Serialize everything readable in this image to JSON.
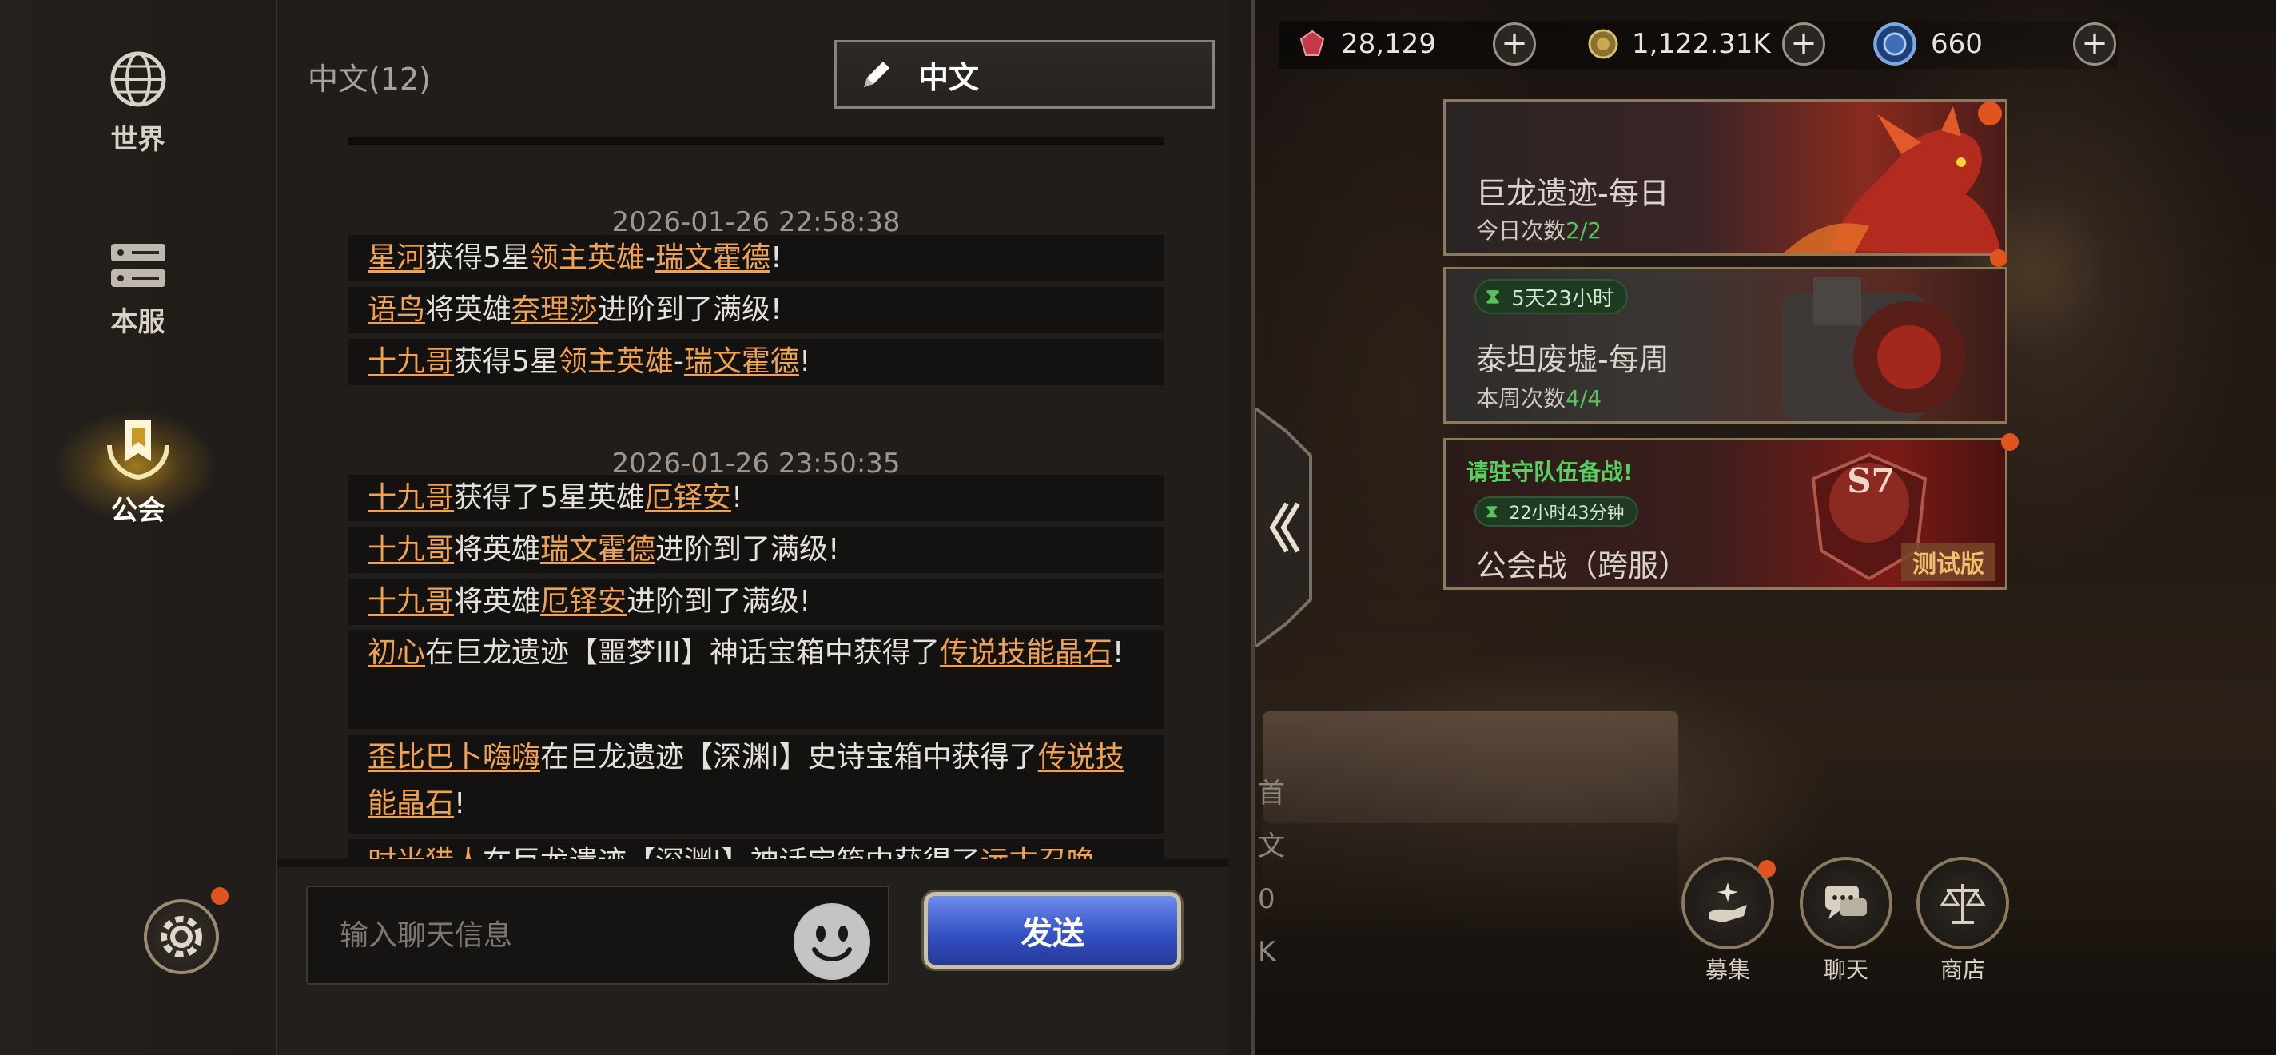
{
  "left_nav": {
    "items": [
      {
        "label": "世界",
        "icon": "globe-icon"
      },
      {
        "label": "本服",
        "icon": "server-icon"
      },
      {
        "label": "公会",
        "icon": "guild-emblem-icon",
        "active": true
      }
    ]
  },
  "chat": {
    "channel_title": "中文(12)",
    "language_button": "中文",
    "groups": [
      {
        "timestamp": "2026-01-26 22:58:38",
        "messages": [
          [
            {
              "t": "星河",
              "l": true
            },
            {
              "t": "获得5星"
            },
            {
              "t": "领主英雄",
              "o": true
            },
            {
              "t": "-"
            },
            {
              "t": "瑞文霍德",
              "l": true
            },
            {
              "t": "!"
            }
          ],
          [
            {
              "t": "语鸟",
              "l": true
            },
            {
              "t": "将英雄"
            },
            {
              "t": "奈理莎",
              "l": true
            },
            {
              "t": "进阶到了满级!"
            }
          ],
          [
            {
              "t": "十九哥",
              "l": true
            },
            {
              "t": "获得5星"
            },
            {
              "t": "领主英雄",
              "o": true
            },
            {
              "t": "-"
            },
            {
              "t": "瑞文霍德",
              "l": true
            },
            {
              "t": "!"
            }
          ]
        ]
      },
      {
        "timestamp": "2026-01-26 23:50:35",
        "messages": [
          [
            {
              "t": "十九哥",
              "l": true
            },
            {
              "t": "获得了5星英雄"
            },
            {
              "t": "厄铎安",
              "l": true
            },
            {
              "t": "!"
            }
          ],
          [
            {
              "t": "十九哥",
              "l": true
            },
            {
              "t": "将英雄"
            },
            {
              "t": "瑞文霍德",
              "l": true
            },
            {
              "t": "进阶到了满级!"
            }
          ],
          [
            {
              "t": "十九哥",
              "l": true
            },
            {
              "t": "将英雄"
            },
            {
              "t": "厄铎安",
              "l": true
            },
            {
              "t": "进阶到了满级!"
            }
          ],
          [
            {
              "t": "初心",
              "l": true
            },
            {
              "t": "在巨龙遗迹【噩梦III】神话宝箱中获得了"
            },
            {
              "t": "传说技能晶石",
              "l": true
            },
            {
              "t": "!"
            }
          ],
          [
            {
              "t": "歪比巴卜嗨嗨",
              "l": true
            },
            {
              "t": "在巨龙遗迹【深渊Ⅰ】史诗宝箱中获得了"
            },
            {
              "t": "传说技能晶石",
              "l": true
            },
            {
              "t": "!"
            }
          ],
          [
            {
              "t": "时光猎人",
              "l": true
            },
            {
              "t": "在巨龙遗迹【深渊Ⅰ】神话宝箱中获得了"
            },
            {
              "t": "远古召唤",
              "l": true
            }
          ]
        ]
      }
    ],
    "input_placeholder": "输入聊天信息",
    "send_label": "发送"
  },
  "resources": [
    {
      "value": "28,129",
      "icon": "red-gem-icon",
      "color": "#c23a48"
    },
    {
      "value": "1,122.31K",
      "icon": "gold-coin-icon",
      "color": "#c9a94a"
    },
    {
      "value": "660",
      "icon": "blue-medal-icon",
      "color": "#3c6fb8"
    }
  ],
  "events": [
    {
      "title": "巨龙遗迹-每日",
      "sub_label": "今日次数",
      "sub_value": "2/2"
    },
    {
      "timer": "5天23小时",
      "title": "泰坦废墟-每周",
      "sub_label": "本周次数",
      "sub_value": "4/4"
    },
    {
      "notice": "请驻守队伍备战!",
      "timer": "22小时43分钟",
      "title": "公会战（跨服）",
      "badge": "S7",
      "tag": "测试版"
    }
  ],
  "bottom_buttons": [
    {
      "label": "募集",
      "icon": "recruit-icon"
    },
    {
      "label": "聊天",
      "icon": "chat-bubble-icon"
    },
    {
      "label": "商店",
      "icon": "scales-icon"
    }
  ],
  "background_text": [
    "首",
    "文",
    "0",
    "K"
  ]
}
